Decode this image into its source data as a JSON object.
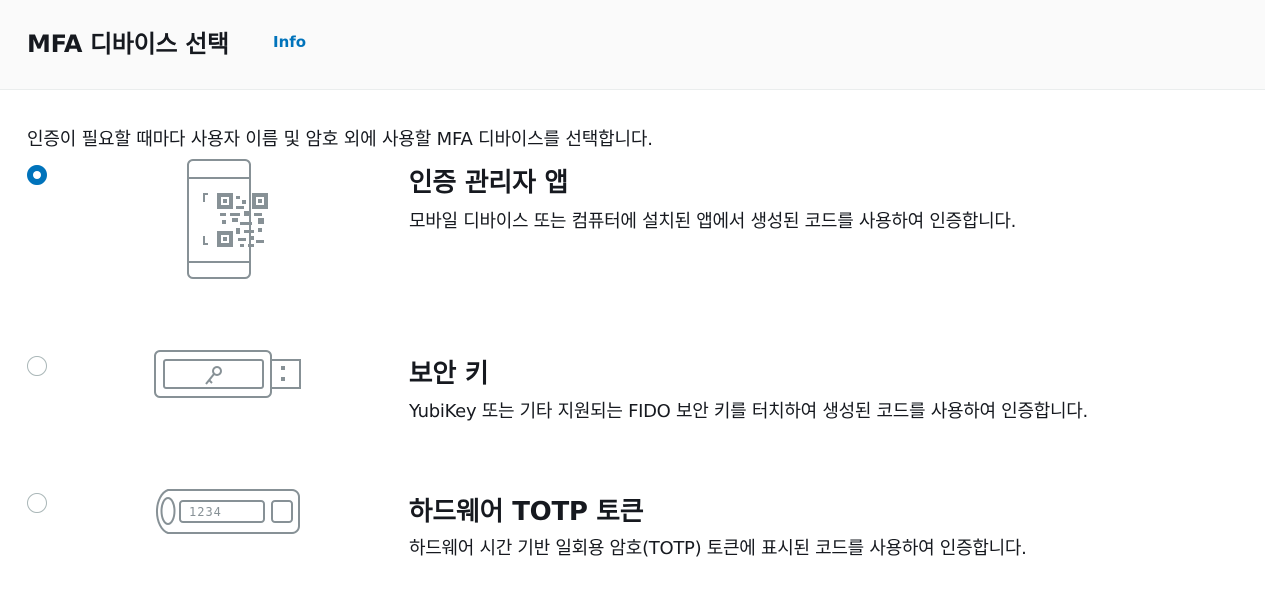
{
  "header": {
    "title": "MFA 디바이스 선택",
    "info_link": "Info"
  },
  "description": "인증이 필요할 때마다 사용자 이름 및 암호 외에 사용할 MFA 디바이스를 선택합니다.",
  "options": [
    {
      "title": "인증 관리자 앱",
      "description": "모바일 디바이스 또는 컴퓨터에 설치된 앱에서 생성된 코드를 사용하여 인증합니다.",
      "selected": true,
      "icon": "phone-qr-icon"
    },
    {
      "title": "보안 키",
      "description": "YubiKey 또는 기타 지원되는 FIDO 보안 키를 터치하여 생성된 코드를 사용하여 인증합니다.",
      "selected": false,
      "icon": "usb-security-key-icon"
    },
    {
      "title": "하드웨어 TOTP 토큰",
      "description": "하드웨어 시간 기반 일회용 암호(TOTP) 토큰에 표시된 코드를 사용하여 인증합니다.",
      "selected": false,
      "icon": "hardware-token-icon",
      "token_display": "1234"
    }
  ],
  "colors": {
    "accent": "#0073bb",
    "icon_stroke": "#879196",
    "text": "#16191f"
  }
}
